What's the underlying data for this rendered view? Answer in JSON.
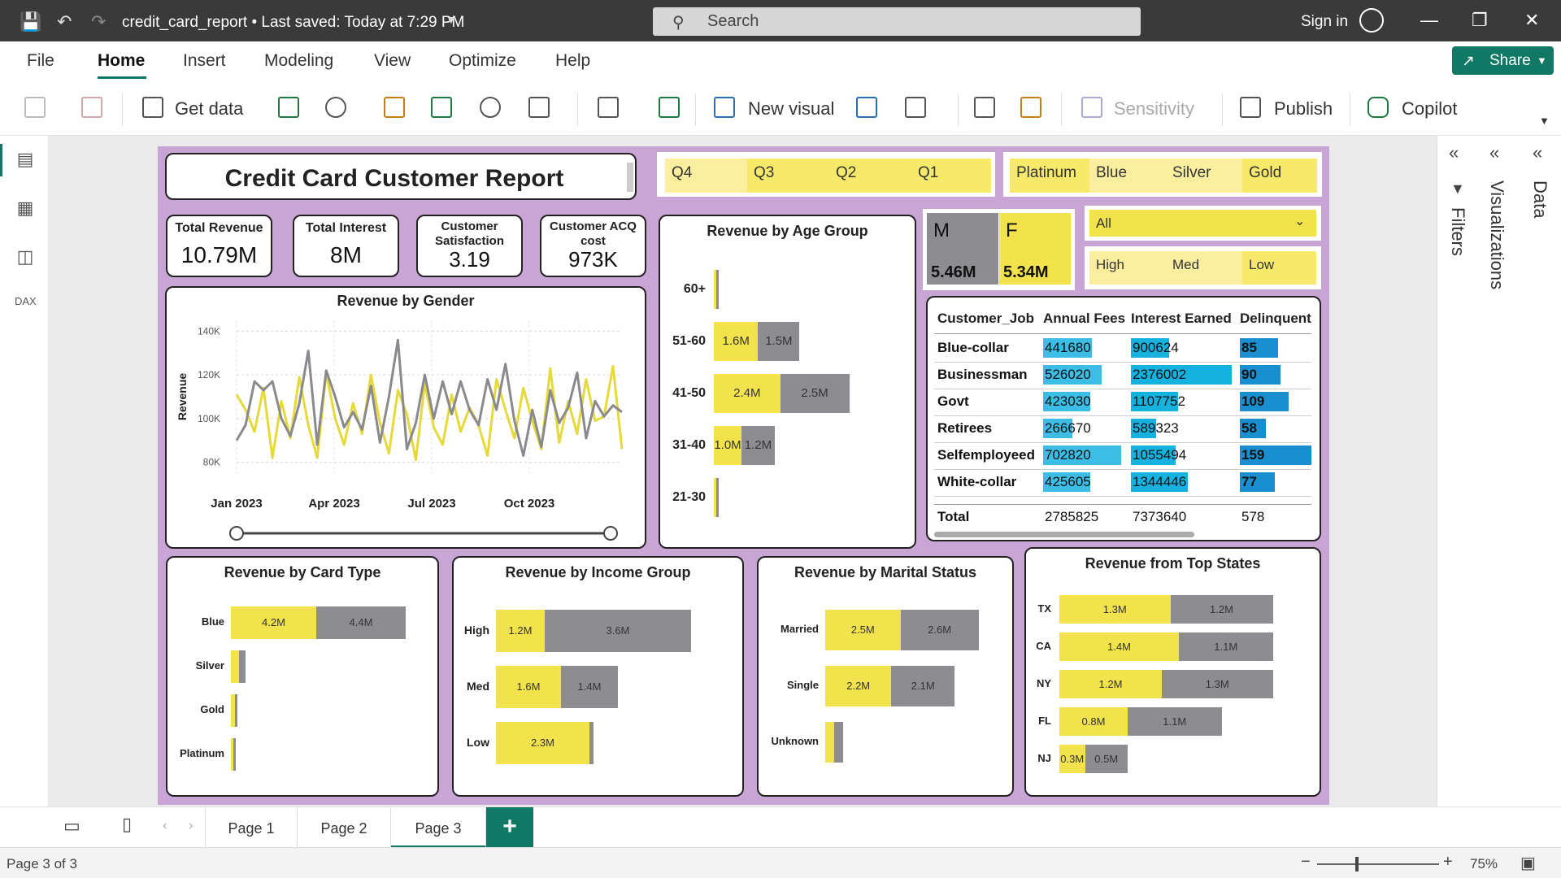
{
  "titlebar": {
    "doc_title": "credit_card_report • Last saved: Today at 7:29 PM",
    "search_placeholder": "Search",
    "sign_in": "Sign in"
  },
  "menu": {
    "items": [
      "File",
      "Home",
      "Insert",
      "Modeling",
      "View",
      "Optimize",
      "Help"
    ],
    "active": "Home",
    "share": "Share"
  },
  "ribbon": {
    "get_data": "Get data",
    "new_visual": "New visual",
    "sensitivity": "Sensitivity",
    "publish": "Publish",
    "copilot": "Copilot"
  },
  "right_panels": {
    "filters": "Filters",
    "visualizations": "Visualizations",
    "data": "Data"
  },
  "report": {
    "title": "Credit Card Customer Report",
    "kpis": [
      {
        "label": "Total Revenue",
        "value": "10.79M"
      },
      {
        "label": "Total Interest",
        "value": "8M"
      },
      {
        "label": "Customer Satisfaction",
        "value": "3.19"
      },
      {
        "label": "Customer ACQ cost",
        "value": "973K"
      }
    ],
    "quarter_slicer": [
      "Q4",
      "Q3",
      "Q2",
      "Q1"
    ],
    "card_slicer": [
      "Platinum",
      "Blue",
      "Silver",
      "Gold"
    ],
    "gender_slicer": [
      {
        "label": "M",
        "value": "5.46M"
      },
      {
        "label": "F",
        "value": "5.34M"
      }
    ],
    "dropdown": {
      "selected": "All"
    },
    "income_slicer": [
      "High",
      "Med",
      "Low"
    ],
    "age_chart_title": "Revenue by Age Group",
    "gender_chart_title": "Revenue by Gender",
    "card_type_title": "Revenue by Card Type",
    "income_title": "Revenue by Income Group",
    "marital_title": "Revenue by Marital Status",
    "states_title": "Revenue from Top States",
    "table": {
      "headers": [
        "Customer_Job",
        "Annual Fees",
        "Interest Earned",
        "Delinquent"
      ],
      "rows": [
        {
          "job": "Blue-collar",
          "fees": "441680",
          "interest": "900624",
          "delinquent": "85"
        },
        {
          "job": "Businessman",
          "fees": "526020",
          "interest": "2376002",
          "delinquent": "90"
        },
        {
          "job": "Govt",
          "fees": "423030",
          "interest": "1107752",
          "delinquent": "109"
        },
        {
          "job": "Retirees",
          "fees": "266670",
          "interest": "589323",
          "delinquent": "58"
        },
        {
          "job": "Selfemployeed",
          "fees": "702820",
          "interest": "1055494",
          "delinquent": "159"
        },
        {
          "job": "White-collar",
          "fees": "425605",
          "interest": "1344446",
          "delinquent": "77"
        }
      ],
      "total": {
        "job": "Total",
        "fees": "2785825",
        "interest": "7373640",
        "delinquent": "578"
      }
    }
  },
  "chart_data": [
    {
      "type": "line",
      "title": "Revenue by Gender",
      "ylabel": "Revenue",
      "ylim": [
        75000,
        145000
      ],
      "yticks": [
        "80K",
        "100K",
        "120K",
        "140K"
      ],
      "xticks": [
        "Jan 2023",
        "Apr 2023",
        "Jul 2023",
        "Oct 2023"
      ],
      "series": [
        {
          "color": "#e6d93a",
          "values": [
            111,
            104,
            94,
            114,
            82,
            108,
            91,
            119,
            97,
            82,
            121,
            100,
            88,
            107,
            93,
            120,
            98,
            84,
            113,
            102,
            81,
            116,
            96,
            88,
            111,
            94,
            105,
            97,
            83,
            118,
            104,
            91,
            114,
            99,
            86,
            123,
            89,
            108,
            93,
            118,
            99,
            101,
            124,
            86
          ]
        },
        {
          "color": "#8a8a8e",
          "values": [
            90,
            97,
            117,
            113,
            117,
            100,
            92,
            107,
            131,
            88,
            122,
            110,
            96,
            103,
            95,
            115,
            89,
            110,
            136,
            86,
            98,
            120,
            100,
            117,
            102,
            117,
            104,
            97,
            118,
            104,
            125,
            99,
            83,
            104,
            87,
            113,
            98,
            105,
            121,
            91,
            108,
            101,
            106,
            103
          ]
        }
      ]
    },
    {
      "type": "bar",
      "title": "Revenue by Age Group",
      "categories": [
        "60+",
        "51-60",
        "41-50",
        "31-40",
        "21-30"
      ],
      "series": [
        {
          "values": [
            0.1,
            1.6,
            2.4,
            1.0,
            0.05
          ],
          "labels": [
            "",
            "1.6M",
            "2.4M",
            "1.0M",
            ""
          ]
        },
        {
          "values": [
            0.05,
            1.5,
            2.5,
            1.2,
            0.05
          ],
          "labels": [
            "",
            "1.5M",
            "2.5M",
            "1.2M",
            ""
          ]
        }
      ]
    },
    {
      "type": "bar",
      "title": "Revenue by Card Type",
      "categories": [
        "Blue",
        "Silver",
        "Gold",
        "Platinum"
      ],
      "series": [
        {
          "values": [
            4.2,
            0.4,
            0.2,
            0.05
          ],
          "labels": [
            "4.2M",
            "",
            "",
            ""
          ]
        },
        {
          "values": [
            4.4,
            0.3,
            0.1,
            0.05
          ],
          "labels": [
            "4.4M",
            "",
            "",
            ""
          ]
        }
      ]
    },
    {
      "type": "bar",
      "title": "Revenue by Income Group",
      "categories": [
        "High",
        "Med",
        "Low"
      ],
      "series": [
        {
          "values": [
            1.2,
            1.6,
            2.3
          ],
          "labels": [
            "1.2M",
            "1.6M",
            "2.3M"
          ]
        },
        {
          "values": [
            3.6,
            1.4,
            0.1
          ],
          "labels": [
            "3.6M",
            "1.4M",
            ""
          ]
        }
      ]
    },
    {
      "type": "bar",
      "title": "Revenue by Marital Status",
      "categories": [
        "Married",
        "Single",
        "Unknown"
      ],
      "series": [
        {
          "values": [
            2.5,
            2.2,
            0.3
          ],
          "labels": [
            "2.5M",
            "2.2M",
            ""
          ]
        },
        {
          "values": [
            2.6,
            2.1,
            0.3
          ],
          "labels": [
            "2.6M",
            "2.1M",
            ""
          ]
        }
      ]
    },
    {
      "type": "bar",
      "title": "Revenue from Top States",
      "categories": [
        "TX",
        "CA",
        "NY",
        "FL",
        "NJ"
      ],
      "series": [
        {
          "values": [
            1.3,
            1.4,
            1.2,
            0.8,
            0.3
          ],
          "labels": [
            "1.3M",
            "1.4M",
            "1.2M",
            "0.8M",
            "0.3M"
          ]
        },
        {
          "values": [
            1.2,
            1.1,
            1.3,
            1.1,
            0.5
          ],
          "labels": [
            "1.2M",
            "1.1M",
            "1.3M",
            "1.1M",
            "0.5M"
          ]
        }
      ]
    }
  ],
  "pages": {
    "tabs": [
      "Page 1",
      "Page 2",
      "Page 3"
    ],
    "active": "Page 3",
    "add": "+"
  },
  "status": {
    "page_info": "Page 3 of 3",
    "zoom": "75%"
  },
  "colors": {
    "accent": "#117865",
    "yellow": "#f2e24b",
    "gray": "#8d8d91",
    "purple": "#c9a5d5",
    "databar": "#1aa3d6"
  }
}
